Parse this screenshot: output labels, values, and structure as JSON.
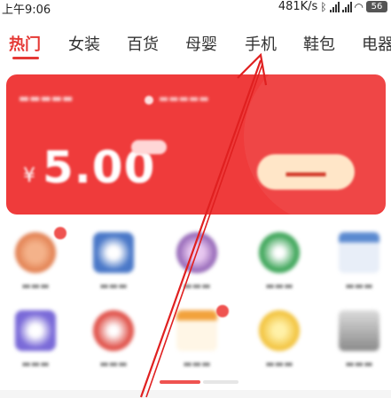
{
  "status_bar": {
    "time": "上午9:06",
    "network_speed": "481K/s",
    "battery": "56",
    "icons": [
      "bluetooth-icon",
      "signal-icon",
      "signal-icon",
      "wifi-icon",
      "battery-icon"
    ]
  },
  "tabs": [
    {
      "label": "热门",
      "active": true
    },
    {
      "label": "女装",
      "active": false
    },
    {
      "label": "百货",
      "active": false
    },
    {
      "label": "母婴",
      "active": false
    },
    {
      "label": "手机",
      "active": false
    },
    {
      "label": "鞋包",
      "active": false
    },
    {
      "label": "电器",
      "active": false
    }
  ],
  "colors": {
    "accent": "#e53935",
    "card": "#ef3b3b",
    "cta_bg": "#ffe6c8"
  },
  "promo_card": {
    "currency": "¥",
    "amount": "5.00"
  },
  "grid_icons": [
    "clock-icon",
    "airplane-icon",
    "camera-icon",
    "tree-icon",
    "calendar-icon",
    "phone-icon",
    "gift-bag-icon",
    "calendar-check-icon",
    "piggy-bank-icon",
    "device-icon"
  ]
}
